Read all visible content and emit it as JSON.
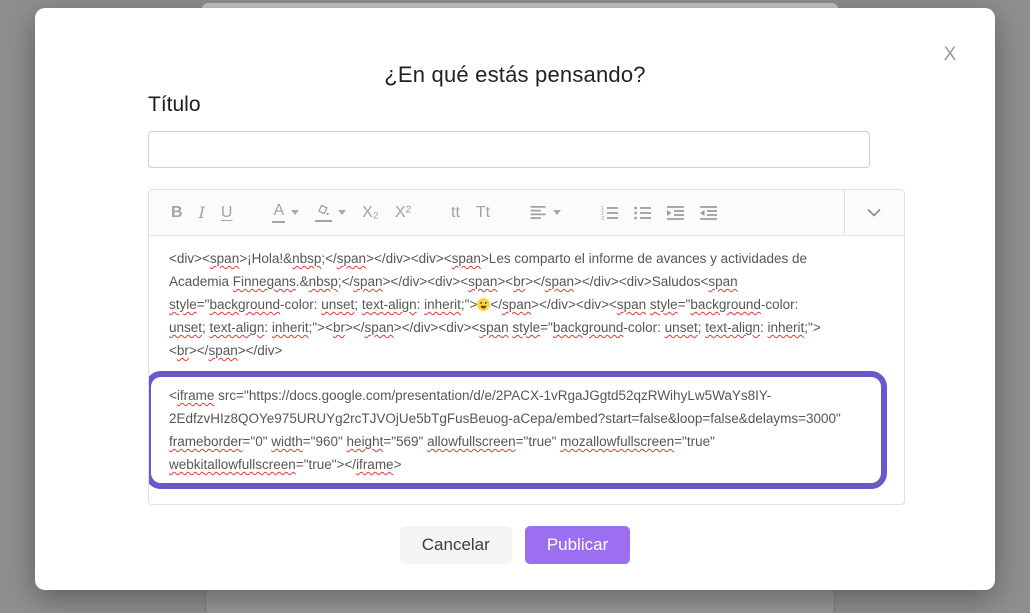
{
  "overlay": {
    "backdrop_color": "#8f8f8f"
  },
  "modal": {
    "close_icon": "X",
    "title": "¿En qué estás pensando?",
    "title_field": {
      "label": "Título",
      "value": "",
      "placeholder": ""
    },
    "editor": {
      "toolbar": [
        {
          "name": "bold",
          "type": "text",
          "glyph": "B",
          "class": "g-bold"
        },
        {
          "name": "italic",
          "type": "text",
          "glyph": "I",
          "class": "g-italic"
        },
        {
          "name": "underline",
          "type": "text",
          "glyph": "U",
          "class": "g-underline"
        },
        {
          "name": "text-color",
          "type": "text",
          "glyph": "A",
          "underline_bar": true,
          "dropdown": true,
          "group_gap": true
        },
        {
          "name": "highlight-color",
          "type": "icon",
          "icon": "highlight",
          "underline_bar": true,
          "dropdown": true
        },
        {
          "name": "subscript",
          "type": "text",
          "glyph": "X₂"
        },
        {
          "name": "superscript",
          "type": "text",
          "glyph": "X²"
        },
        {
          "name": "font-size",
          "type": "text",
          "glyph": "tt",
          "group_gap": true
        },
        {
          "name": "text-case",
          "type": "text",
          "glyph": "Tt"
        },
        {
          "name": "alignment",
          "type": "icon",
          "icon": "align",
          "dropdown": true,
          "group_gap": true
        },
        {
          "name": "ordered-list",
          "type": "icon",
          "icon": "ol",
          "group_gap": true
        },
        {
          "name": "unordered-list",
          "type": "icon",
          "icon": "ul"
        },
        {
          "name": "indent",
          "type": "icon",
          "icon": "indent"
        },
        {
          "name": "outdent",
          "type": "icon",
          "icon": "outdent"
        },
        {
          "name": "more-options",
          "type": "icon",
          "icon": "chevron-down",
          "far_right": true
        }
      ],
      "content_lines": [
        [
          {
            "t": "<div><"
          },
          {
            "t": "span",
            "w": true
          },
          {
            "t": ">¡Hola!&"
          },
          {
            "t": "nbsp",
            "w": true
          },
          {
            "t": ";</"
          },
          {
            "t": "span",
            "w": true
          },
          {
            "t": "></div><div><"
          },
          {
            "t": "span",
            "w": true
          },
          {
            "t": ">Les comparto el informe de avances y actividades de"
          }
        ],
        [
          {
            "t": "Academia "
          },
          {
            "t": "Finnegans",
            "w": true
          },
          {
            "t": ".&"
          },
          {
            "t": "nbsp",
            "w": true
          },
          {
            "t": ";</"
          },
          {
            "t": "span",
            "w": true
          },
          {
            "t": "></div><div><"
          },
          {
            "t": "span",
            "w": true
          },
          {
            "t": "><"
          },
          {
            "t": "br",
            "w": true
          },
          {
            "t": "></"
          },
          {
            "t": "span",
            "w": true
          },
          {
            "t": "></div><div>Saludos<"
          },
          {
            "t": "span",
            "w": true
          }
        ],
        [
          {
            "t": "style",
            "w": true
          },
          {
            "t": "=\""
          },
          {
            "t": "background",
            "w": true
          },
          {
            "t": "-color: "
          },
          {
            "t": "unset",
            "w": true
          },
          {
            "t": "; "
          },
          {
            "t": "text-align",
            "w": true
          },
          {
            "t": ": "
          },
          {
            "t": "inherit",
            "w": true
          },
          {
            "t": ";\">"
          },
          {
            "t": "😀",
            "emoji": true
          },
          {
            "t": "</"
          },
          {
            "t": "span",
            "w": true
          },
          {
            "t": "></div><div><"
          },
          {
            "t": "span",
            "w": true
          },
          {
            "t": " "
          },
          {
            "t": "style",
            "w": true
          },
          {
            "t": "=\""
          },
          {
            "t": "background",
            "w": true
          },
          {
            "t": "-color:"
          }
        ],
        [
          {
            "t": "unset",
            "w": true
          },
          {
            "t": "; "
          },
          {
            "t": "text-align",
            "w": true
          },
          {
            "t": ": "
          },
          {
            "t": "inherit",
            "w": true
          },
          {
            "t": ";\"><"
          },
          {
            "t": "br",
            "w": true
          },
          {
            "t": "></"
          },
          {
            "t": "span",
            "w": true
          },
          {
            "t": "></div><div><"
          },
          {
            "t": "span",
            "w": true
          },
          {
            "t": " "
          },
          {
            "t": "style",
            "w": true
          },
          {
            "t": "=\""
          },
          {
            "t": "background",
            "w": true
          },
          {
            "t": "-color: "
          },
          {
            "t": "unset",
            "w": true
          },
          {
            "t": "; "
          },
          {
            "t": "text-align",
            "w": true
          },
          {
            "t": ": "
          },
          {
            "t": "inherit",
            "w": true
          },
          {
            "t": ";\">"
          }
        ],
        [
          {
            "t": "<"
          },
          {
            "t": "br",
            "w": true
          },
          {
            "t": "></"
          },
          {
            "t": "span",
            "w": true
          },
          {
            "t": "></div>"
          }
        ]
      ],
      "embed_highlight": {
        "border_color": "#6659cc",
        "lines": [
          [
            {
              "t": "<"
            },
            {
              "t": "iframe",
              "w": true
            },
            {
              "t": " src=\"https://docs.google.com/presentation/d/e/2PACX-1vRgaJGgtd52qzRWihyLw5WaYs8IY-"
            }
          ],
          [
            {
              "t": "2EdfzvHIz8QOYe975URUYg2rcTJVOjUe5bTgFusBeuog-aCepa/embed?start=false&loop=false&delayms=3000\""
            }
          ],
          [
            {
              "t": "frameborder",
              "w": true
            },
            {
              "t": "=\"0\" "
            },
            {
              "t": "width",
              "w": true
            },
            {
              "t": "=\"960\" "
            },
            {
              "t": "height",
              "w": true
            },
            {
              "t": "=\"569\" "
            },
            {
              "t": "allowfullscreen",
              "w": true
            },
            {
              "t": "=\"true\" "
            },
            {
              "t": "mozallowfullscreen",
              "w": true
            },
            {
              "t": "=\"true\""
            }
          ],
          [
            {
              "t": "webkitallowfullscreen",
              "w": true
            },
            {
              "t": "=\"true\"></"
            },
            {
              "t": "iframe",
              "w": true
            },
            {
              "t": ">"
            }
          ]
        ]
      }
    },
    "actions": {
      "cancel_label": "Cancelar",
      "publish_label": "Publicar",
      "publish_color": "#9c6ef0"
    }
  }
}
